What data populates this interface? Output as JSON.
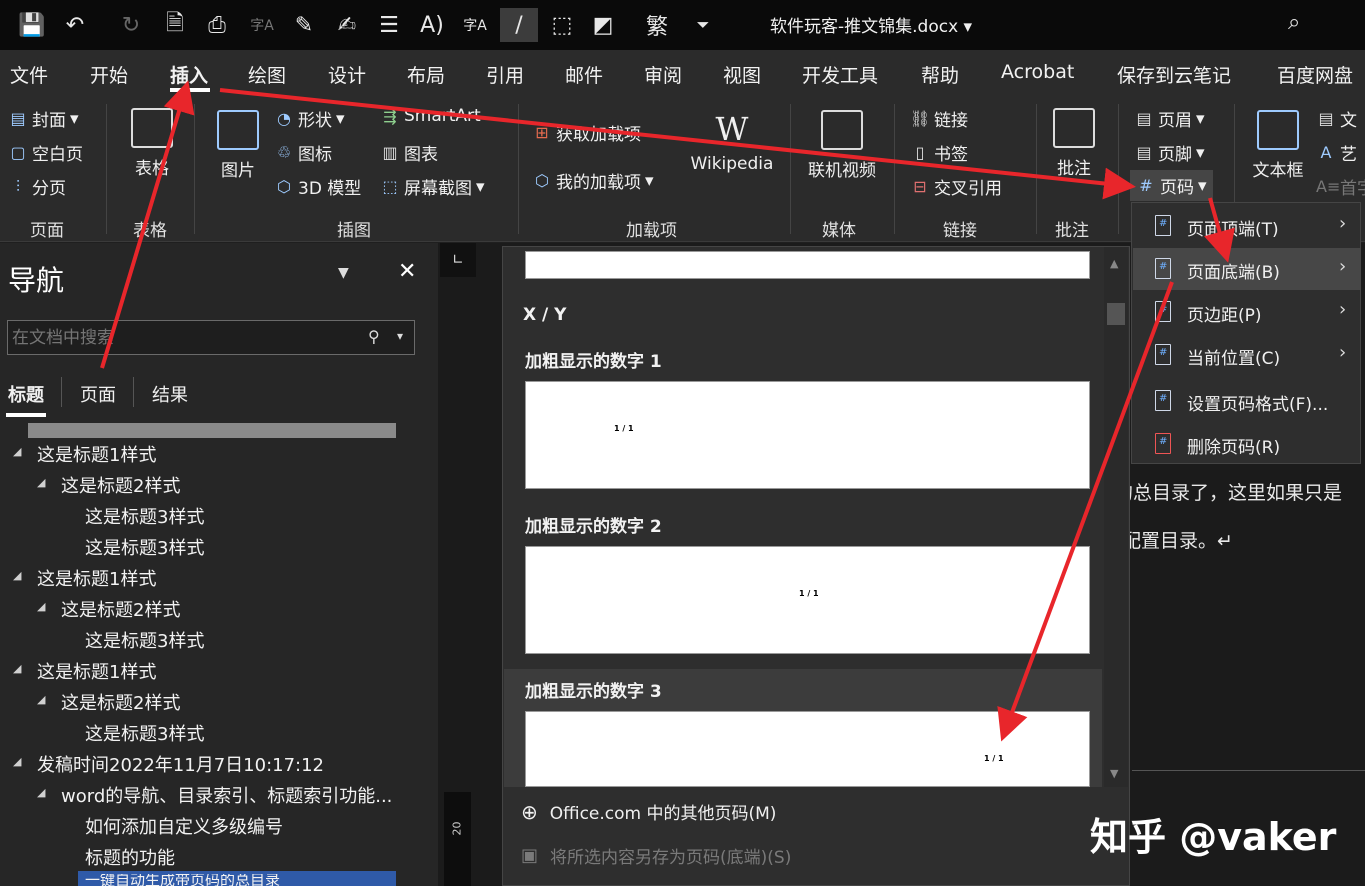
{
  "window": {
    "title": "软件玩客-推文锦集.docx"
  },
  "menu_tabs": [
    "文件",
    "开始",
    "插入",
    "绘图",
    "设计",
    "布局",
    "引用",
    "邮件",
    "审阅",
    "视图",
    "开发工具",
    "帮助",
    "Acrobat",
    "保存到云笔记",
    "百度网盘"
  ],
  "ribbon": {
    "pages": {
      "items": [
        "封面",
        "空白页",
        "分页"
      ],
      "label": "页面"
    },
    "table": {
      "item": "表格",
      "label": "表格"
    },
    "illustrations": {
      "picture": "图片",
      "shape": "形状",
      "icon": "图标",
      "model3d": "3D 模型",
      "smartart": "SmartArt",
      "chart": "图表",
      "screenshot": "屏幕截图",
      "label": "插图"
    },
    "addins": {
      "get": "获取加载项",
      "mine": "我的加载项",
      "wikipedia": "Wikipedia",
      "label": "加载项"
    },
    "media": {
      "online_video": "联机视频",
      "label": "媒体"
    },
    "links": {
      "link": "链接",
      "bookmark": "书签",
      "crossref": "交叉引用",
      "label": "链接"
    },
    "comments": {
      "comment": "批注",
      "label": "批注"
    },
    "header_footer": {
      "header": "页眉",
      "footer": "页脚",
      "page_number": "页码"
    },
    "text": {
      "textbox": "文本框",
      "doc": "文",
      "art": "艺",
      "dropcap": "首字"
    }
  },
  "nav": {
    "title": "导航",
    "search_placeholder": "在文档中搜索",
    "tabs": [
      "标题",
      "页面",
      "结果"
    ],
    "headings": [
      "这是标题1样式",
      "这是标题2样式",
      "这是标题3样式",
      "这是标题3样式",
      "这是标题1样式",
      "这是标题2样式",
      "这是标题3样式",
      "这是标题1样式",
      "这是标题2样式",
      "这是标题3样式",
      "发稿时间2022年11月7日10:17:12",
      "word的导航、目录索引、标题索引功能...",
      "如何添加自定义多级编号",
      "标题的功能",
      "一键自动生成带页码的总目录"
    ]
  },
  "gallery": {
    "section": "X / Y",
    "items": [
      {
        "title": "加粗显示的数字 1",
        "num": "1 / 1"
      },
      {
        "title": "加粗显示的数字 2",
        "num": "1 / 1"
      },
      {
        "title": "加粗显示的数字 3",
        "num": "1 / 1"
      }
    ],
    "more": "Office.com 中的其他页码(M)",
    "save": "将所选内容另存为页码(底端)(S)"
  },
  "submenu": {
    "items": [
      "页面顶端(T)",
      "页面底端(B)",
      "页边距(P)",
      "当前位置(C)",
      "设置页码格式(F)...",
      "删除页码(R)"
    ]
  },
  "document": {
    "line1": "的总目录了，这里如果只是",
    "line2": "配置目录。↵"
  },
  "ruler": {
    "mark": "20"
  },
  "watermark": "知乎 @vaker",
  "accent_colors": {
    "arrow": "#e8262b",
    "icon": "#9ecbff",
    "selection": "#2f5aa8"
  }
}
